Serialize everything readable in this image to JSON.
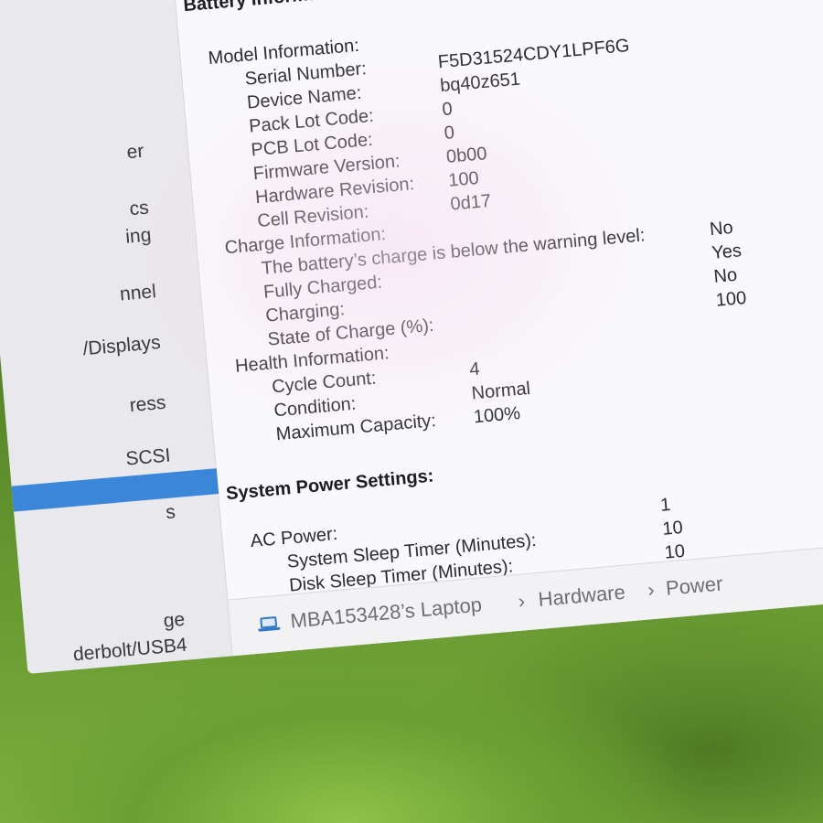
{
  "sidebar": {
    "items": [
      {
        "label": "er"
      },
      {
        "label": "cs"
      },
      {
        "label": "ing"
      },
      {
        "label": "nnel"
      },
      {
        "label": "/Displays"
      },
      {
        "label": "ress"
      },
      {
        "label": "SCSI"
      },
      {
        "label": ""
      },
      {
        "label": "s"
      },
      {
        "label": "ge"
      },
      {
        "label": "derbolt/USB4"
      }
    ],
    "selected_index": 7
  },
  "battery": {
    "title": "Battery Information:",
    "model_header": "Model Information:",
    "model": [
      {
        "key": "Serial Number:",
        "value": "F5D31524CDY1LPF6G"
      },
      {
        "key": "Device Name:",
        "value": "bq40z651"
      },
      {
        "key": "Pack Lot Code:",
        "value": "0"
      },
      {
        "key": "PCB Lot Code:",
        "value": "0"
      },
      {
        "key": "Firmware Version:",
        "value": "0b00"
      },
      {
        "key": "Hardware Revision:",
        "value": "100"
      },
      {
        "key": "Cell Revision:",
        "value": "0d17"
      }
    ],
    "charge_header": "Charge Information:",
    "charge": [
      {
        "key": "The battery’s charge is below the warning level:",
        "value": "No"
      },
      {
        "key": "Fully Charged:",
        "value": "Yes"
      },
      {
        "key": "Charging:",
        "value": "No"
      },
      {
        "key": "State of Charge (%):",
        "value": "100"
      }
    ],
    "health_header": "Health Information:",
    "health": [
      {
        "key": "Cycle Count:",
        "value": "4"
      },
      {
        "key": "Condition:",
        "value": "Normal"
      },
      {
        "key": "Maximum Capacity:",
        "value": "100%"
      }
    ]
  },
  "power": {
    "title": "System Power Settings:",
    "ac_header": "AC Power:",
    "ac_value": "1",
    "rows": [
      {
        "key": "System Sleep Timer (Minutes):",
        "value": "10"
      },
      {
        "key": "Disk Sleep Timer (Minutes):",
        "value": "10"
      }
    ]
  },
  "path_bar": {
    "device": "MBA153428’s Laptop",
    "sep1": "›",
    "section": "Hardware",
    "sep2": "›",
    "page": "Power"
  },
  "colors": {
    "selection": "#3b86d8",
    "wallpaper_green": "#6aa032"
  },
  "icons": {
    "path_device": "laptop-icon"
  }
}
